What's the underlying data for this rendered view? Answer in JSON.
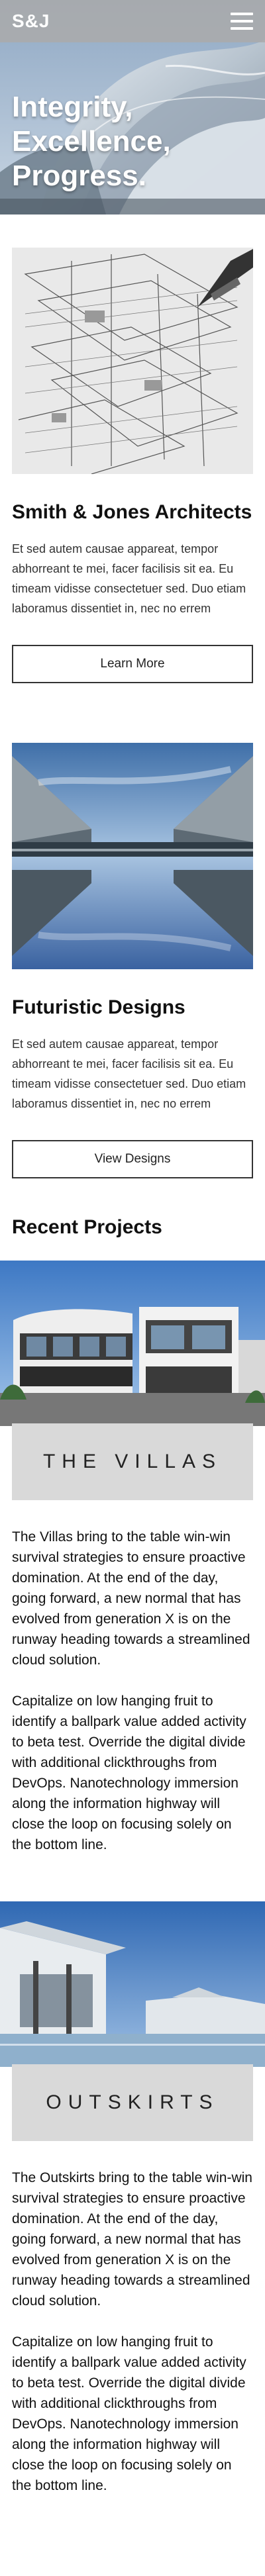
{
  "nav": {
    "brand": "S&J"
  },
  "hero": {
    "title_lines": [
      "Integrity,",
      "Excellence,",
      "Progress."
    ]
  },
  "cards": [
    {
      "title": "Smith & Jones Architects",
      "text": "Et sed autem causae appareat, tempor abhorreant te mei, facer facilisis sit ea. Eu timeam vidisse consectetuer sed. Duo etiam laboramus dissentiet in, nec no errem",
      "button": "Learn More"
    },
    {
      "title": "Futuristic Designs",
      "text": "Et sed autem causae appareat, tempor abhorreant te mei, facer facilisis sit ea. Eu timeam vidisse consectetuer sed. Duo etiam laboramus dissentiet in, nec no errem",
      "button": "View Designs"
    }
  ],
  "recent": {
    "title": "Recent Projects",
    "projects": [
      {
        "name": "THE VILLAS",
        "p1": "The Villas bring to the table win-win survival strategies to ensure proactive domination. At the end of the day, going forward, a new normal that has evolved from generation X is on the runway heading towards a streamlined cloud solution.",
        "p2": "Capitalize on low hanging fruit to identify a ballpark value added activity to beta test. Override the digital divide with additional clickthroughs from DevOps. Nanotechnology immersion along the information highway will close the loop on focusing solely on the bottom line."
      },
      {
        "name": "OUTSKIRTS",
        "p1": "The Outskirts bring to the table win-win survival strategies to ensure proactive domination. At the end of the day, going forward, a new normal that has evolved from generation X is on the runway heading towards a streamlined cloud solution.",
        "p2": "Capitalize on low hanging fruit to identify a ballpark value added activity to beta test. Override the digital divide with additional clickthroughs from DevOps. Nanotechnology immersion along the information highway will close the loop on focusing solely on the bottom line."
      }
    ]
  },
  "colors": {
    "navbar": "#aaaaaa",
    "label_bg": "#d9d9d9",
    "text": "#222222"
  },
  "icons": {
    "menu": "hamburger-menu-icon"
  }
}
